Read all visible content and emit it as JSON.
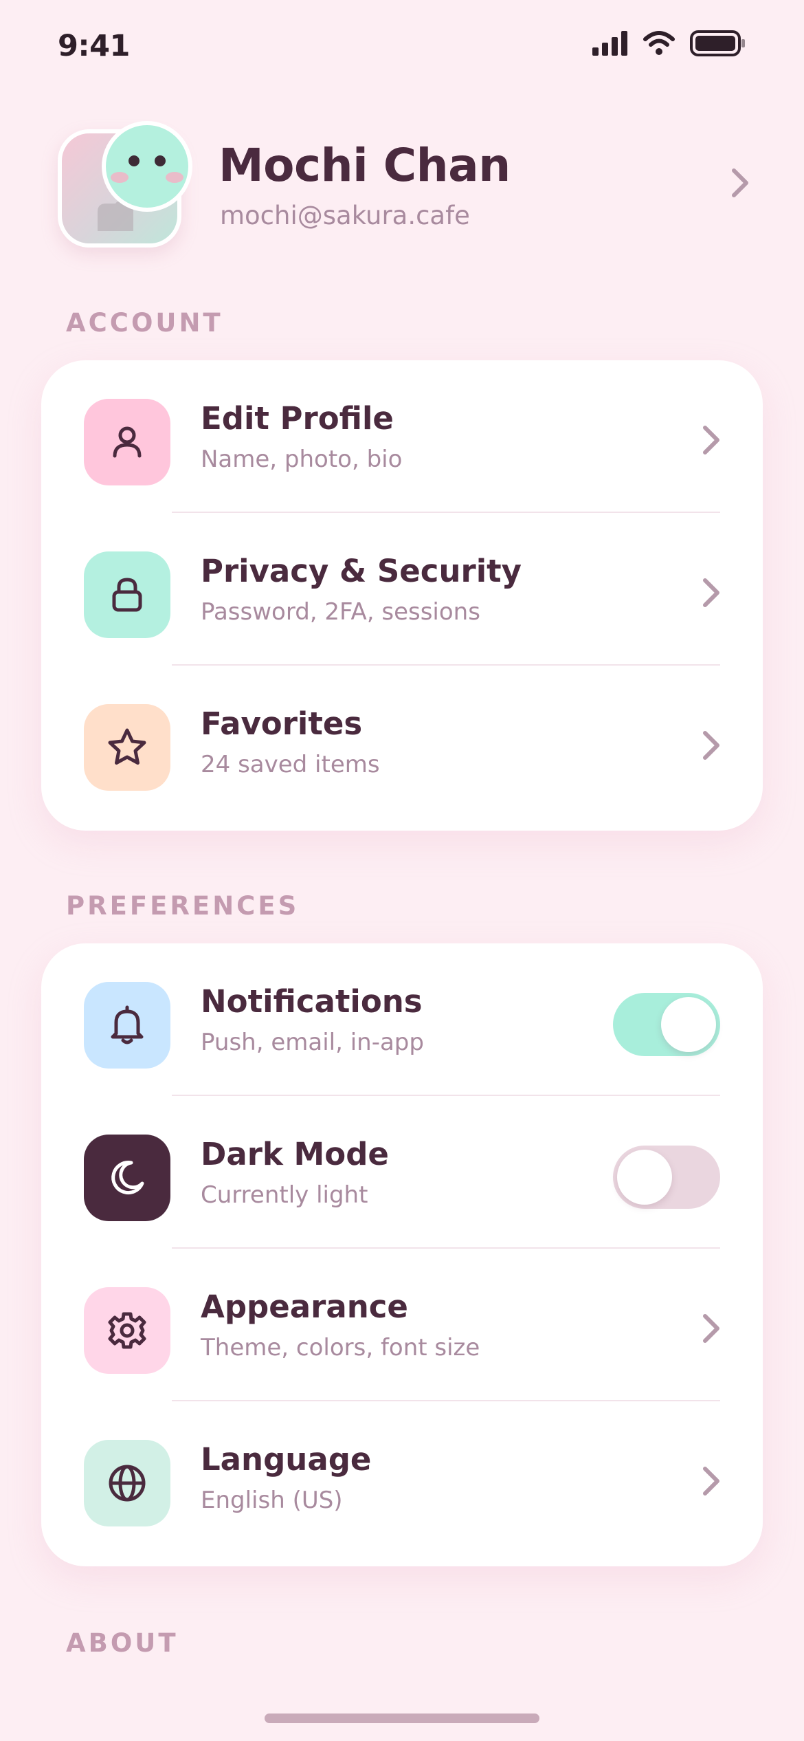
{
  "status_bar": {
    "time": "9:41",
    "icons": [
      "signal-icon",
      "wifi-icon",
      "battery-icon"
    ]
  },
  "profile": {
    "name": "Mochi Chan",
    "email": "mochi@sakura.cafe"
  },
  "sections": {
    "account": {
      "label": "ACCOUNT",
      "items": [
        {
          "title": "Edit Profile",
          "subtitle": "Name, photo, bio",
          "icon": "person-icon",
          "icon_bg": "#ffc6dc",
          "control": "chevron"
        },
        {
          "title": "Privacy & Security",
          "subtitle": "Password, 2FA, sessions",
          "icon": "lock-icon",
          "icon_bg": "#b4f0e0",
          "control": "chevron"
        },
        {
          "title": "Favorites",
          "subtitle": "24 saved items",
          "icon": "star-icon",
          "icon_bg": "#ffdfca",
          "control": "chevron"
        }
      ]
    },
    "preferences": {
      "label": "PREFERENCES",
      "items": [
        {
          "title": "Notifications",
          "subtitle": "Push, email, in-app",
          "icon": "bell-icon",
          "icon_bg": "#c9e6ff",
          "control": "toggle",
          "enabled": true
        },
        {
          "title": "Dark Mode",
          "subtitle": "Currently light",
          "icon": "moon-icon",
          "icon_bg": "#4a2a3e",
          "control": "toggle",
          "enabled": false
        },
        {
          "title": "Appearance",
          "subtitle": "Theme, colors, font size",
          "icon": "gear-icon",
          "icon_bg": "#ffd6e8",
          "control": "chevron"
        },
        {
          "title": "Language",
          "subtitle": "English (US)",
          "icon": "globe-icon",
          "icon_bg": "#d2f0e6",
          "control": "chevron"
        }
      ]
    },
    "about": {
      "label": "ABOUT"
    }
  },
  "colors": {
    "background": "#fdeef3",
    "text_primary": "#4a2a3e",
    "text_secondary": "#a88a9e",
    "section_label": "#c49bb0",
    "toggle_on": "#a8eedb",
    "toggle_off": "#ead6df"
  }
}
